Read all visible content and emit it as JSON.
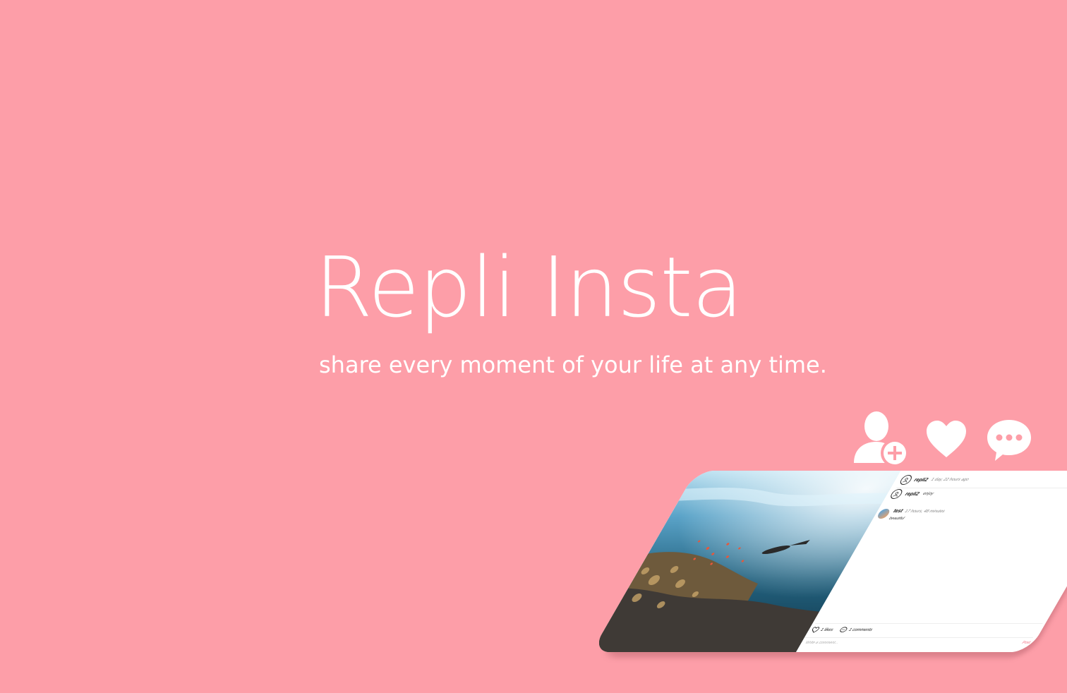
{
  "hero": {
    "title": "Repli Insta",
    "tagline": "share every moment of your life at any time."
  },
  "feature_icons": [
    "add-user-icon",
    "heart-icon",
    "chat-bubble-icon"
  ],
  "colors": {
    "background": "#fd9ea8",
    "text": "#ffffff",
    "accent": "#f36b7f"
  },
  "mockup": {
    "post": {
      "username": "repli2",
      "time_ago": "1 day, 22 hours ago",
      "menu_icon": "more-icon",
      "caption_user": "repli2",
      "caption": "enjoy"
    },
    "comments": [
      {
        "user": "test",
        "time_ago": "17 hours, 48 minutes",
        "text": "beautiful"
      }
    ],
    "actions": {
      "likes": "1 likes",
      "comments": "1 comments"
    },
    "comment_input": {
      "placeholder": "Write a comment...",
      "post_label": "Post"
    }
  }
}
